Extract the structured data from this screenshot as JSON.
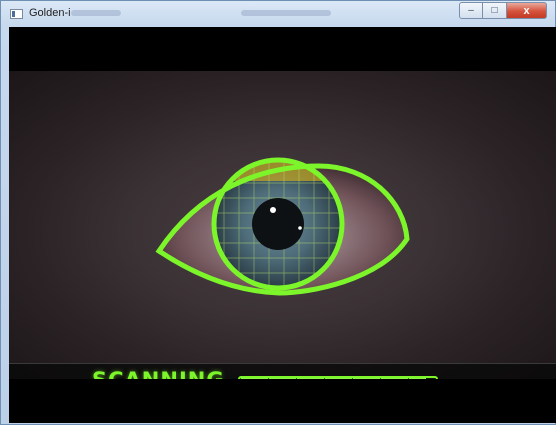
{
  "window": {
    "title": "Golden-i",
    "controls": {
      "minimize": "–",
      "maximize": "□",
      "close": "x"
    }
  },
  "viewer": {
    "status_label": "SCANNING",
    "progress": 0.95,
    "accent_color": "#7cf52a"
  },
  "icons": [
    "app-window-icon",
    "minimize-icon",
    "maximize-icon",
    "close-icon"
  ]
}
